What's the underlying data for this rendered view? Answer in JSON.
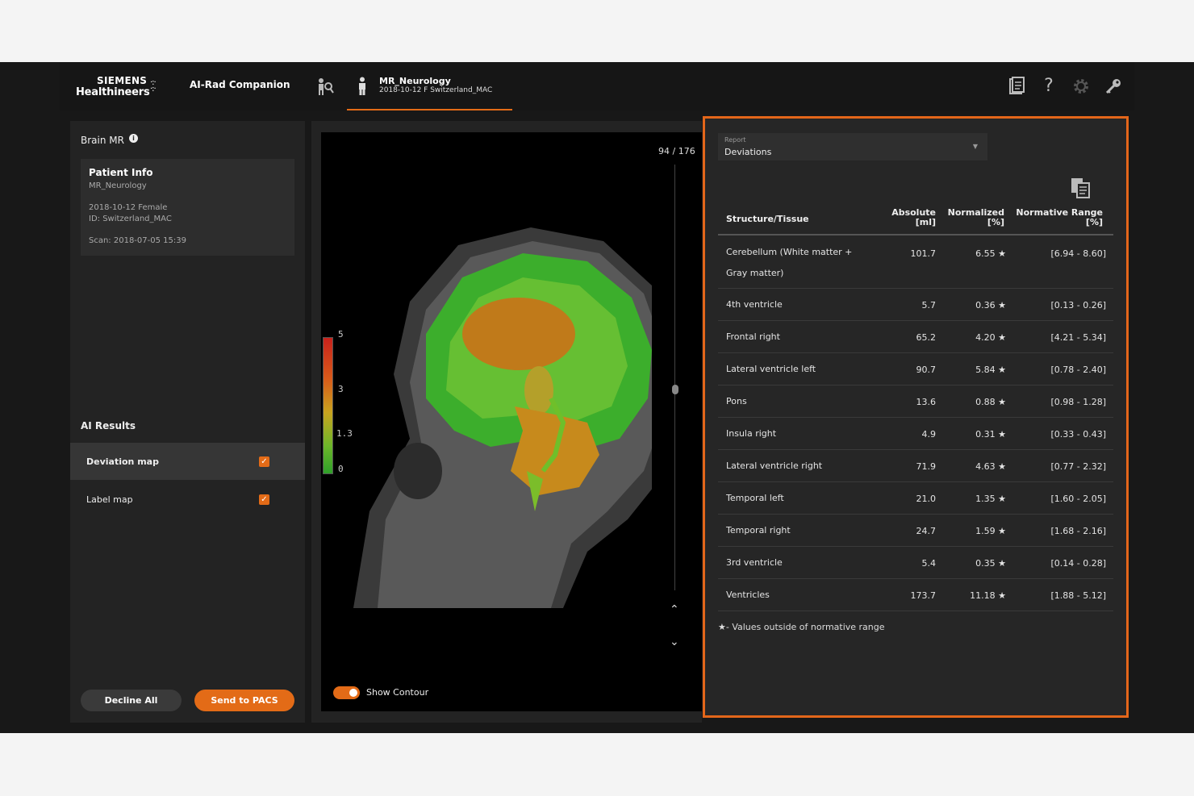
{
  "header": {
    "brand_line1": "SIEMENS",
    "brand_line2": "Healthineers",
    "app_name": "AI-Rad Companion",
    "active_tab_title": "MR_Neurology",
    "active_tab_sub": "2018-10-12 F Switzerland_MAC",
    "icons": [
      "patient-search-icon",
      "report-icon",
      "help-icon",
      "settings-icon",
      "key-icon"
    ]
  },
  "left": {
    "title": "Brain MR",
    "patient": {
      "heading": "Patient Info",
      "name": "MR_Neurology",
      "dob_sex": "2018-10-12 Female",
      "id": "ID: Switzerland_MAC",
      "scan": "Scan: 2018-07-05 15:39"
    },
    "ai_results_title": "AI Results",
    "results": [
      {
        "label": "Deviation map",
        "checked": true,
        "selected": true
      },
      {
        "label": "Label map",
        "checked": true,
        "selected": false
      }
    ],
    "decline_label": "Decline All",
    "send_label": "Send to PACS"
  },
  "viewer": {
    "slice": "94 / 176",
    "colorbar_labels": [
      "5",
      "3",
      "1.3",
      "0"
    ],
    "show_contour_label": "Show Contour",
    "show_contour_on": true,
    "colors": {
      "accent": "#e36b17"
    }
  },
  "report": {
    "dropdown_key": "Report",
    "dropdown_value": "Deviations",
    "columns": {
      "structure": "Structure/Tissue",
      "absolute_1": "Absolute",
      "absolute_2": "[ml]",
      "normalized_1": "Normalized",
      "normalized_2": "[%]",
      "range_1": "Normative Range",
      "range_2": "[%]"
    },
    "rows": [
      {
        "name": "Cerebellum (White matter + Gray matter)",
        "abs": "101.7",
        "norm": "6.55 ★",
        "range": "[6.94 - 8.60]"
      },
      {
        "name": "4th ventricle",
        "abs": "5.7",
        "norm": "0.36 ★",
        "range": "[0.13 - 0.26]"
      },
      {
        "name": "Frontal right",
        "abs": "65.2",
        "norm": "4.20 ★",
        "range": "[4.21 - 5.34]"
      },
      {
        "name": "Lateral ventricle left",
        "abs": "90.7",
        "norm": "5.84 ★",
        "range": "[0.78 - 2.40]"
      },
      {
        "name": "Pons",
        "abs": "13.6",
        "norm": "0.88 ★",
        "range": "[0.98 - 1.28]"
      },
      {
        "name": "Insula right",
        "abs": "4.9",
        "norm": "0.31 ★",
        "range": "[0.33 - 0.43]"
      },
      {
        "name": "Lateral ventricle right",
        "abs": "71.9",
        "norm": "4.63 ★",
        "range": "[0.77 - 2.32]"
      },
      {
        "name": "Temporal left",
        "abs": "21.0",
        "norm": "1.35 ★",
        "range": "[1.60 - 2.05]"
      },
      {
        "name": "Temporal right",
        "abs": "24.7",
        "norm": "1.59 ★",
        "range": "[1.68 - 2.16]"
      },
      {
        "name": "3rd ventricle",
        "abs": "5.4",
        "norm": "0.35 ★",
        "range": "[0.14 - 0.28]"
      },
      {
        "name": "Ventricles",
        "abs": "173.7",
        "norm": "11.18 ★",
        "range": "[1.88 - 5.12]"
      }
    ],
    "footnote": "★- Values outside of normative range"
  }
}
